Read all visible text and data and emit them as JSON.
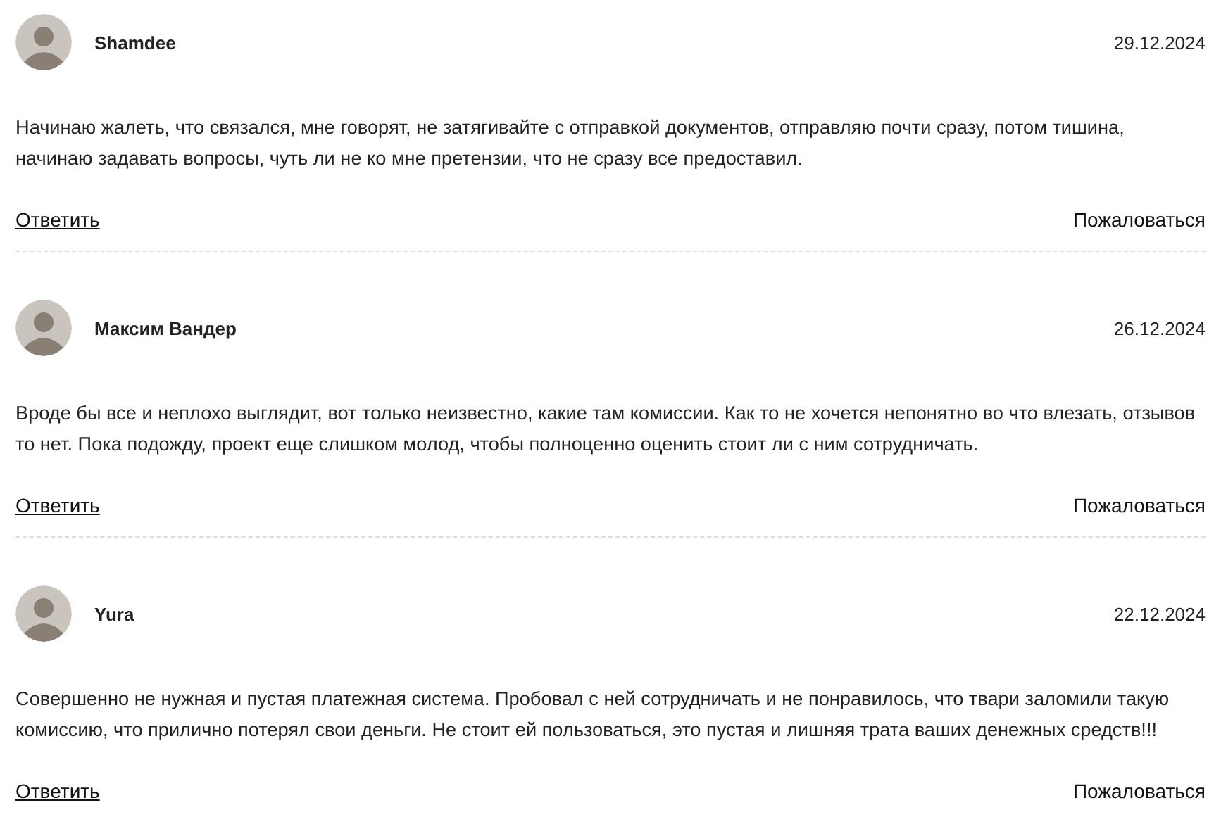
{
  "comments": [
    {
      "author": "Shamdee",
      "date": "29.12.2024",
      "text": "Начинаю жалеть, что связался, мне говорят, не затягивайте с отправкой документов, отправляю почти сразу, потом тишина, начинаю задавать вопросы, чуть ли не ко мне претензии, что не сразу все предоставил.",
      "reply": "Ответить",
      "report": "Пожаловаться"
    },
    {
      "author": "Максим Вандер",
      "date": "26.12.2024",
      "text": "Вроде бы все и неплохо выглядит, вот только неизвестно, какие там комиссии. Как то не хочется непонятно во что влезать, отзывов то нет. Пока подожду, проект еще слишком молод, чтобы полноценно оценить стоит ли с ним сотрудничать.",
      "reply": "Ответить",
      "report": "Пожаловаться"
    },
    {
      "author": "Yura",
      "date": "22.12.2024",
      "text": "Совершенно не нужная и пустая платежная система. Пробовал с ней сотрудничать и не понравилось, что твари заломили такую комиссию, что прилично потерял свои деньги. Не стоит ей пользоваться, это пустая и лишняя трата ваших денежных средств!!!",
      "reply": "Ответить",
      "report": "Пожаловаться"
    }
  ]
}
